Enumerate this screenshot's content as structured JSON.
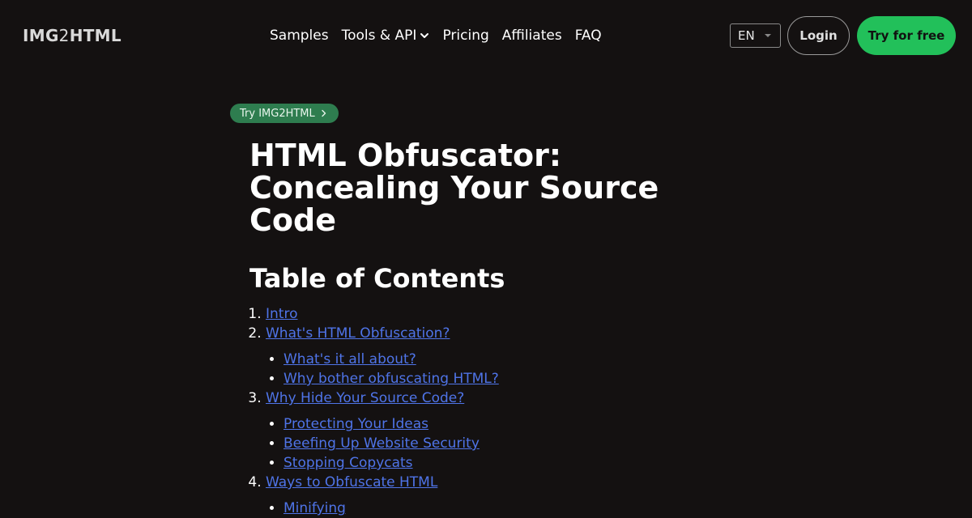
{
  "header": {
    "logo_part1": "IMG",
    "logo_part2": "2",
    "logo_part3": "HTML",
    "nav": [
      "Samples",
      "Tools & API",
      "Pricing",
      "Affiliates",
      "FAQ"
    ],
    "lang": "EN",
    "login_label": "Login",
    "try_label": "Try for free"
  },
  "pill_label": "Try IMG2HTML",
  "article": {
    "title": "HTML Obfuscator: Concealing Your Source Code",
    "toc_heading": "Table of Contents",
    "toc": [
      {
        "label": "Intro",
        "children": []
      },
      {
        "label": "What's HTML Obfuscation?",
        "children": [
          "What's it all about?",
          "Why bother obfuscating HTML?"
        ]
      },
      {
        "label": "Why Hide Your Source Code?",
        "children": [
          "Protecting Your Ideas",
          "Beefing Up Website Security",
          "Stopping Copycats"
        ]
      },
      {
        "label": "Ways to Obfuscate HTML",
        "children": [
          "Minifying"
        ]
      }
    ]
  },
  "colors": {
    "background": "#141111",
    "accent_green": "#22c05a",
    "pill_green": "#2e7d4f",
    "link_blue": "#4f74e8"
  }
}
